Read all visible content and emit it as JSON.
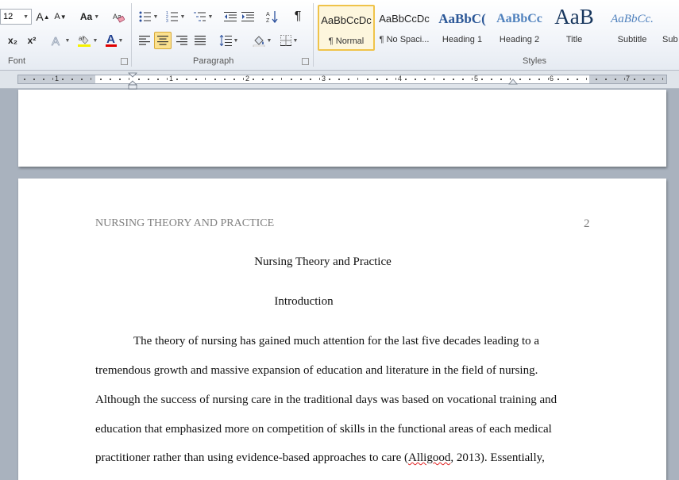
{
  "ribbon": {
    "font_group": {
      "label": "Font",
      "font_size": "12",
      "grow_font": "A",
      "shrink_font": "A",
      "change_case": "Aa",
      "subscript": "x₂",
      "superscript": "x²",
      "font_color_letter": "A",
      "highlight_color": "#f6f200",
      "font_color": "#e00000"
    },
    "paragraph_group": {
      "label": "Paragraph",
      "pilcrow": "¶"
    },
    "styles_group": {
      "label": "Styles",
      "items": [
        {
          "sample": "AaBbCcDc",
          "name": "¶ Normal"
        },
        {
          "sample": "AaBbCcDc",
          "name": "¶ No Spaci..."
        },
        {
          "sample": "AaBbC(",
          "name": "Heading 1"
        },
        {
          "sample": "AaBbCc",
          "name": "Heading 2"
        },
        {
          "sample": "AaB",
          "name": "Title"
        },
        {
          "sample": "AaBbCc.",
          "name": "Subtitle"
        },
        {
          "sample": "",
          "name": "Sub"
        }
      ]
    }
  },
  "ruler": {
    "numbers": [
      "1",
      "1",
      "2",
      "3",
      "4",
      "5",
      "6",
      "7"
    ]
  },
  "document": {
    "running_header": "NURSING THEORY AND PRACTICE",
    "page_number": "2",
    "title": "Nursing Theory and Practice",
    "section_heading": "Introduction",
    "lines": [
      "The theory of nursing has gained much attention for the last five decades leading to a",
      "tremendous growth and massive  expansion of education and literature in the field of nursing.",
      "Although the success of nursing care in the traditional days was based on vocational training and",
      "education that emphasized more on competition of skills in the functional areas of each medical",
      "practitioner rather than using evidence-based approaches to care ("
    ],
    "citation_author": "Alligood",
    "citation_tail": ", 2013). Essentially,"
  }
}
